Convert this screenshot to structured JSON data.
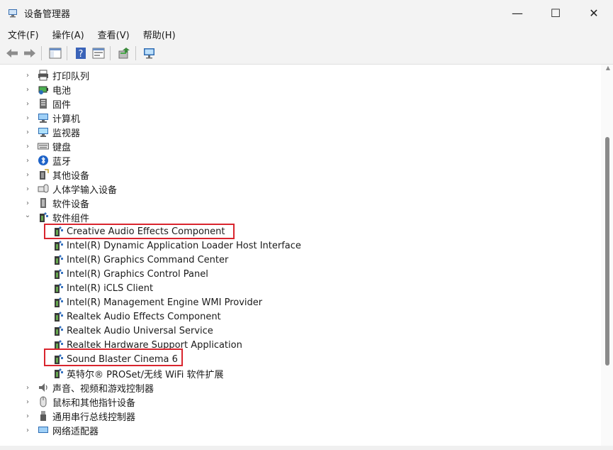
{
  "window": {
    "title": "设备管理器"
  },
  "controls": {
    "minimize": "—",
    "maximize": "☐",
    "close": "✕"
  },
  "menu": [
    {
      "label": "文件(F)"
    },
    {
      "label": "操作(A)"
    },
    {
      "label": "查看(V)"
    },
    {
      "label": "帮助(H)"
    }
  ],
  "tree": {
    "categories_top": [
      {
        "label": "打印队列",
        "icon": "printer-icon"
      },
      {
        "label": "电池",
        "icon": "battery-icon"
      },
      {
        "label": "固件",
        "icon": "firmware-icon"
      },
      {
        "label": "计算机",
        "icon": "computer-icon"
      },
      {
        "label": "监视器",
        "icon": "monitor-icon"
      },
      {
        "label": "键盘",
        "icon": "keyboard-icon"
      },
      {
        "label": "蓝牙",
        "icon": "bluetooth-icon"
      },
      {
        "label": "其他设备",
        "icon": "other-devices-icon"
      },
      {
        "label": "人体学输入设备",
        "icon": "hid-icon"
      },
      {
        "label": "软件设备",
        "icon": "software-device-icon"
      }
    ],
    "expanded": {
      "label": "软件组件",
      "icon": "software-component-icon"
    },
    "children": [
      {
        "label": "Creative Audio Effects Component"
      },
      {
        "label": "Intel(R) Dynamic Application Loader Host Interface"
      },
      {
        "label": "Intel(R) Graphics Command Center"
      },
      {
        "label": "Intel(R) Graphics Control Panel"
      },
      {
        "label": "Intel(R) iCLS Client"
      },
      {
        "label": "Intel(R) Management Engine WMI Provider"
      },
      {
        "label": "Realtek Audio Effects Component"
      },
      {
        "label": "Realtek Audio Universal Service"
      },
      {
        "label": "Realtek Hardware Support Application"
      },
      {
        "label": "Sound Blaster Cinema 6"
      },
      {
        "label": "英特尔® PROSet/无线 WiFi 软件扩展"
      }
    ],
    "categories_bottom": [
      {
        "label": "声音、视频和游戏控制器",
        "icon": "sound-icon"
      },
      {
        "label": "鼠标和其他指针设备",
        "icon": "mouse-icon"
      },
      {
        "label": "通用串行总线控制器",
        "icon": "usb-icon"
      },
      {
        "label": "网络适配器",
        "icon": "network-icon"
      }
    ]
  },
  "colors": {
    "highlight": "#d9252e",
    "chrome": "#f3f3f3"
  }
}
